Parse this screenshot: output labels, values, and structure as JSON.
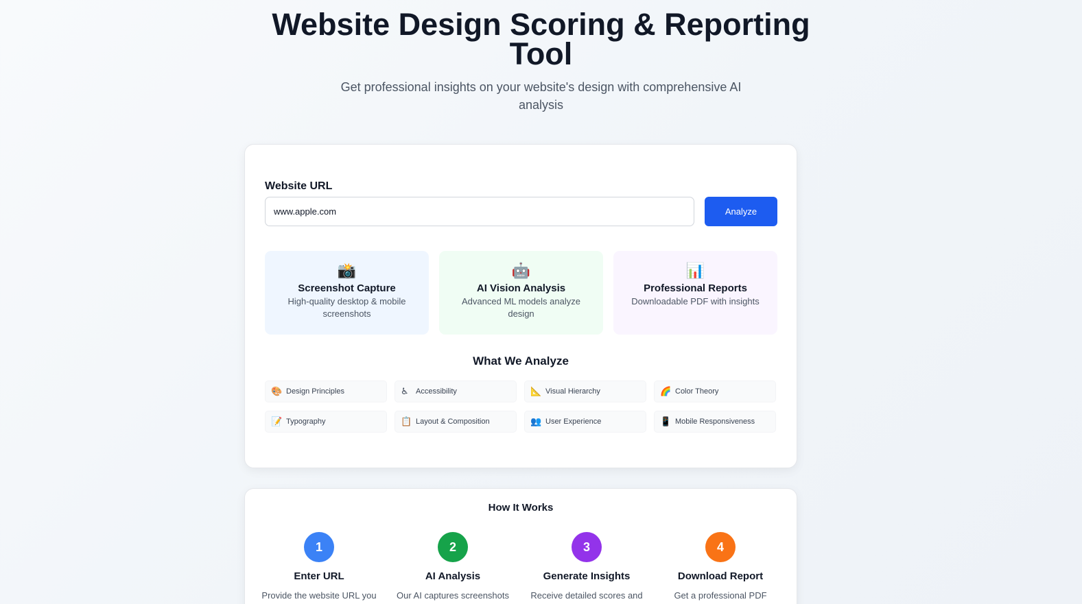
{
  "hero": {
    "title": "Website Design Scoring & Reporting Tool",
    "subtitle": "Get professional insights on your website's design with comprehensive AI analysis"
  },
  "form": {
    "label": "Website URL",
    "url_value": "www.apple.com",
    "button_label": "Analyze"
  },
  "features": [
    {
      "icon": "📸",
      "icon_name": "camera-icon",
      "title": "Screenshot Capture",
      "desc": "High-quality desktop & mobile screenshots",
      "bg": "#eff6ff"
    },
    {
      "icon": "🤖",
      "icon_name": "robot-icon",
      "title": "AI Vision Analysis",
      "desc": "Advanced ML models analyze design",
      "bg": "#f0fdf4"
    },
    {
      "icon": "📊",
      "icon_name": "bar-chart-icon",
      "title": "Professional Reports",
      "desc": "Downloadable PDF with insights",
      "bg": "#faf5ff"
    }
  ],
  "analyze": {
    "title": "What We Analyze",
    "items": [
      {
        "icon": "🎨",
        "icon_name": "palette-icon",
        "label": "Design Principles"
      },
      {
        "icon": "♿",
        "icon_name": "accessibility-icon",
        "label": "Accessibility"
      },
      {
        "icon": "📐",
        "icon_name": "triangle-ruler-icon",
        "label": "Visual Hierarchy"
      },
      {
        "icon": "🌈",
        "icon_name": "rainbow-icon",
        "label": "Color Theory"
      },
      {
        "icon": "📝",
        "icon_name": "memo-icon",
        "label": "Typography"
      },
      {
        "icon": "📋",
        "icon_name": "clipboard-icon",
        "label": "Layout & Composition"
      },
      {
        "icon": "👥",
        "icon_name": "users-icon",
        "label": "User Experience"
      },
      {
        "icon": "📱",
        "icon_name": "mobile-phone-icon",
        "label": "Mobile Responsiveness"
      }
    ]
  },
  "how": {
    "title": "How It Works",
    "steps": [
      {
        "num": "1",
        "title": "Enter URL",
        "desc": "Provide the website URL you",
        "color": "#3b82f6"
      },
      {
        "num": "2",
        "title": "AI Analysis",
        "desc": "Our AI captures screenshots",
        "color": "#16a34a"
      },
      {
        "num": "3",
        "title": "Generate Insights",
        "desc": "Receive detailed scores and",
        "color": "#9333ea"
      },
      {
        "num": "4",
        "title": "Download Report",
        "desc": "Get a professional PDF",
        "color": "#f97316"
      }
    ]
  }
}
